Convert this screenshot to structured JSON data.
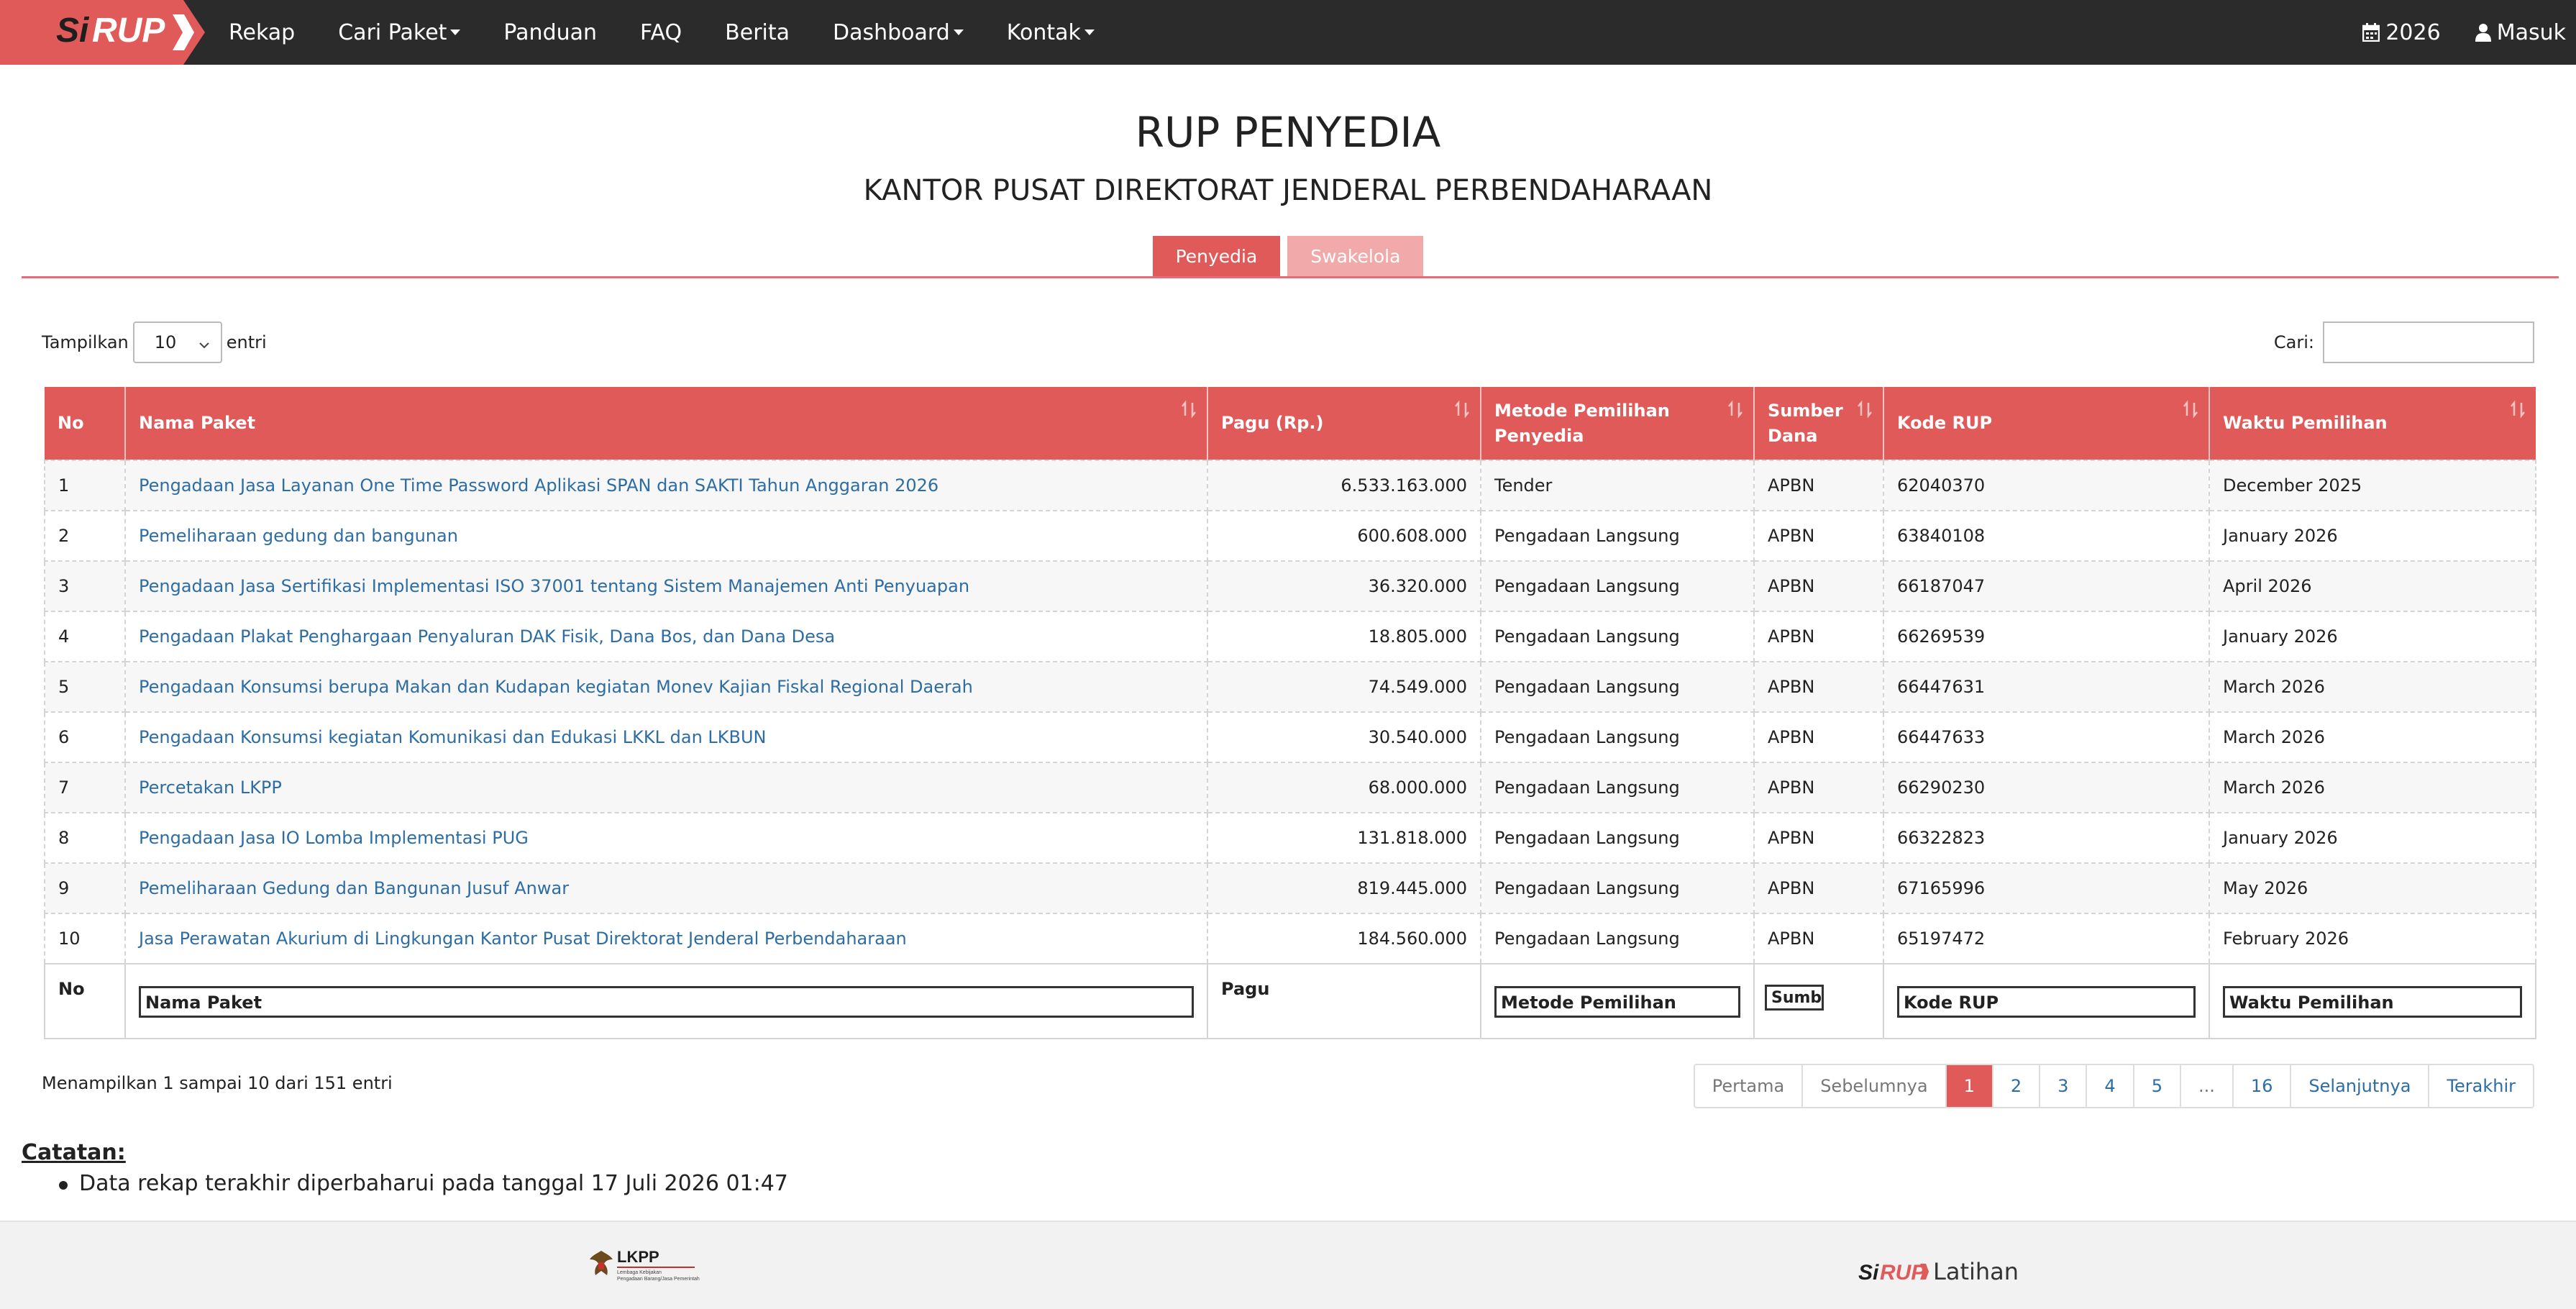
{
  "navbar": {
    "logo_text": "SiRUP",
    "items": [
      {
        "label": "Rekap",
        "dropdown": false
      },
      {
        "label": "Cari Paket",
        "dropdown": true
      },
      {
        "label": "Panduan",
        "dropdown": false
      },
      {
        "label": "FAQ",
        "dropdown": false
      },
      {
        "label": "Berita",
        "dropdown": false
      },
      {
        "label": "Dashboard",
        "dropdown": true
      },
      {
        "label": "Kontak",
        "dropdown": true
      }
    ],
    "year_label": "2026",
    "year_icon": "calendar-icon",
    "login_label": "Masuk",
    "login_icon": "user-icon"
  },
  "page": {
    "title": "RUP PENYEDIA",
    "subtitle": "KANTOR PUSAT DIREKTORAT JENDERAL PERBENDAHARAAN"
  },
  "tabs": [
    {
      "label": "Penyedia",
      "active": true
    },
    {
      "label": "Swakelola",
      "active": false
    }
  ],
  "controls": {
    "show_label": "Tampilkan",
    "page_size": "10",
    "entries_label": "entri",
    "search_label": "Cari:",
    "search_value": ""
  },
  "table": {
    "headers": [
      "No",
      "Nama Paket",
      "Pagu (Rp.)",
      "Metode Pemilihan Penyedia",
      "Sumber Dana",
      "Kode RUP",
      "Waktu Pemilihan"
    ],
    "rows": [
      [
        "1",
        "Pengadaan Jasa Layanan One Time Password Aplikasi SPAN dan SAKTI Tahun Anggaran 2026",
        "6.533.163.000",
        "Tender",
        "APBN",
        "62040370",
        "December 2025"
      ],
      [
        "2",
        "Pemeliharaan gedung dan bangunan",
        "600.608.000",
        "Pengadaan Langsung",
        "APBN",
        "63840108",
        "January 2026"
      ],
      [
        "3",
        "Pengadaan Jasa Sertifikasi Implementasi ISO 37001 tentang Sistem Manajemen Anti Penyuapan",
        "36.320.000",
        "Pengadaan Langsung",
        "APBN",
        "66187047",
        "April 2026"
      ],
      [
        "4",
        "Pengadaan Plakat Penghargaan Penyaluran DAK Fisik, Dana Bos, dan Dana Desa",
        "18.805.000",
        "Pengadaan Langsung",
        "APBN",
        "66269539",
        "January 2026"
      ],
      [
        "5",
        "Pengadaan Konsumsi berupa Makan dan Kudapan kegiatan Monev Kajian Fiskal Regional Daerah",
        "74.549.000",
        "Pengadaan Langsung",
        "APBN",
        "66447631",
        "March 2026"
      ],
      [
        "6",
        "Pengadaan Konsumsi kegiatan Komunikasi dan Edukasi LKKL dan LKBUN",
        "30.540.000",
        "Pengadaan Langsung",
        "APBN",
        "66447633",
        "March 2026"
      ],
      [
        "7",
        "Percetakan LKPP",
        "68.000.000",
        "Pengadaan Langsung",
        "APBN",
        "66290230",
        "March 2026"
      ],
      [
        "8",
        "Pengadaan Jasa IO Lomba Implementasi PUG",
        "131.818.000",
        "Pengadaan Langsung",
        "APBN",
        "66322823",
        "January 2026"
      ],
      [
        "9",
        "Pemeliharaan Gedung dan Bangunan Jusuf Anwar",
        "819.445.000",
        "Pengadaan Langsung",
        "APBN",
        "67165996",
        "May 2026"
      ],
      [
        "10",
        "Jasa Perawatan Akurium di Lingkungan Kantor Pusat Direktorat Jenderal Perbendaharaan",
        "184.560.000",
        "Pengadaan Langsung",
        "APBN",
        "65197472",
        "February 2026"
      ]
    ],
    "footer": {
      "no": "No",
      "nama_paket": "Nama Paket",
      "pagu": "Pagu",
      "metode": "Metode Pemilihan",
      "sumber": "Sumber Dana",
      "kode": "Kode RUP",
      "waktu": "Waktu Pemilihan"
    }
  },
  "info": "Menampilkan 1 sampai 10 dari 151 entri",
  "pagination": {
    "first": "Pertama",
    "prev": "Sebelumnya",
    "pages": [
      "1",
      "2",
      "3",
      "4",
      "5",
      "...",
      "16"
    ],
    "current": "1",
    "next": "Selanjutnya",
    "last": "Terakhir"
  },
  "notes": {
    "title": "Catatan:",
    "items": [
      "Data rekap terakhir diperbaharui pada tanggal 17 Juli 2026 01:47"
    ]
  },
  "footer": {
    "lkpp_text": "LKPP",
    "lkpp_caption_1": "Lembaga Kebijakan",
    "lkpp_caption_2": "Pengadaan Barang/Jasa Pemerintah",
    "sirup_text": "SiRUP",
    "latihan_label": "Latihan"
  },
  "colors": {
    "navbar": "#2b2b2b",
    "brand_red": "#e05a5a",
    "tab_inactive": "#f1a9a9",
    "link": "#2e6da4"
  }
}
